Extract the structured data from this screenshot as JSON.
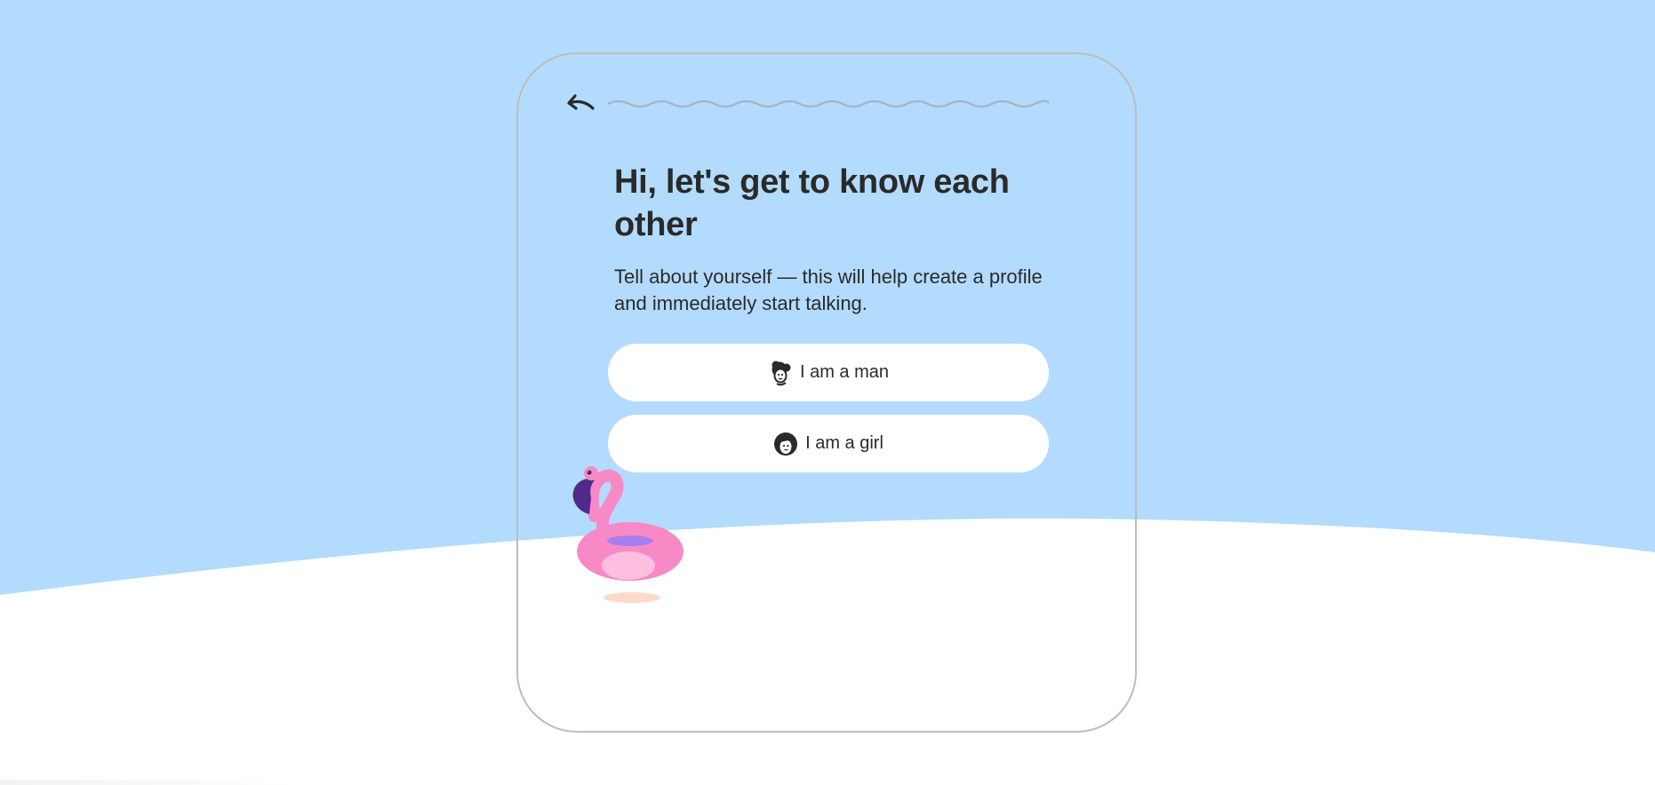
{
  "header": {
    "back_icon": "arrow-back-icon",
    "progress_icon": "wavy-progress-line"
  },
  "main": {
    "title": "Hi, let's get to know each other",
    "subtitle": "Tell about yourself — this will help create a profile and immediately start talking.",
    "options": [
      {
        "label": "I am a man",
        "icon": "man-avatar-icon"
      },
      {
        "label": "I am a girl",
        "icon": "girl-avatar-icon"
      }
    ]
  },
  "decoration": {
    "illustration": "flamingo-float-illustration"
  },
  "colors": {
    "sky": "#b3dbfd",
    "ground": "#ffffff",
    "text": "#2a2a2a",
    "card_border": "#bdbdbd",
    "button_bg": "#ffffff",
    "flamingo_pink": "#f78ac6",
    "flamingo_beak": "#4f2a8a"
  }
}
